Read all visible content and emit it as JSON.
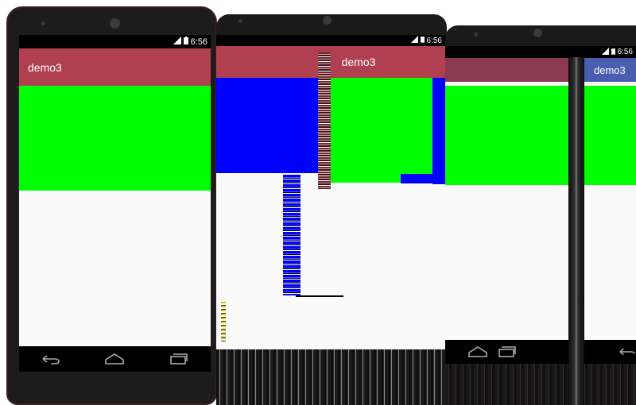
{
  "app": {
    "title": "demo3"
  },
  "status": {
    "time": "6:56"
  },
  "colors": {
    "appbar": "#b04050",
    "content_top": "#00ff00",
    "content_bottom": "#fafafa",
    "glitch_blue": "#0000ff"
  },
  "nav": {
    "back_icon": "back-arrow-icon",
    "home_icon": "home-icon",
    "recents_icon": "recents-icon"
  }
}
